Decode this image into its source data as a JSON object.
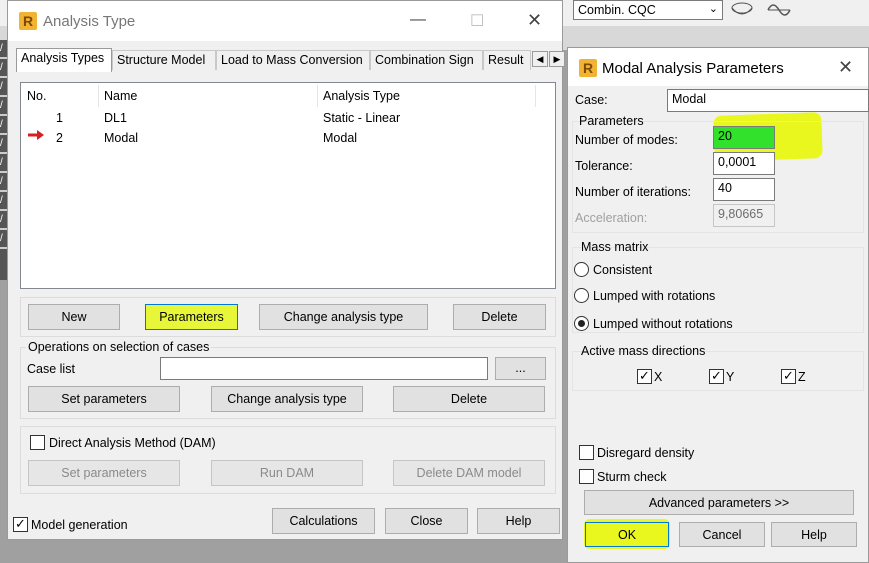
{
  "background": {
    "combo_value": "Combin. CQC",
    "left_marks": [
      "/",
      "/",
      "/",
      "/",
      "/",
      "/",
      "/",
      "/",
      "/",
      "/",
      "/"
    ]
  },
  "analysis_dialog": {
    "title": "Analysis Type",
    "tabs": [
      "Analysis Types",
      "Structure Model",
      "Load to Mass Conversion",
      "Combination Sign",
      "Result"
    ],
    "columns": [
      "No.",
      "Name",
      "Analysis Type"
    ],
    "rows": [
      {
        "no": "1",
        "name": "DL1",
        "type": "Static - Linear"
      },
      {
        "no": "2",
        "name": "Modal",
        "type": "Modal"
      }
    ],
    "buttons": {
      "new": "New",
      "parameters": "Parameters",
      "change_type": "Change analysis type",
      "delete": "Delete"
    },
    "operations": {
      "label": "Operations on selection of cases",
      "case_list_label": "Case list",
      "case_list_value": "",
      "browse": "...",
      "set_parameters": "Set parameters",
      "change_type": "Change analysis type",
      "delete": "Delete"
    },
    "dam": {
      "label": "Direct Analysis Method (DAM)",
      "set_parameters": "Set parameters",
      "run": "Run DAM",
      "delete_model": "Delete DAM model"
    },
    "model_generation": "Model generation",
    "footer": {
      "calculations": "Calculations",
      "close": "Close",
      "help": "Help"
    }
  },
  "modal_dialog": {
    "title": "Modal Analysis Parameters",
    "case_label": "Case:",
    "case_value": "Modal",
    "parameters_label": "Parameters",
    "modes_label": "Number of modes:",
    "modes_value": "20",
    "tolerance_label": "Tolerance:",
    "tolerance_value": "0,0001",
    "iterations_label": "Number of iterations:",
    "iterations_value": "40",
    "acceleration_label": "Acceleration:",
    "acceleration_value": "9,80665",
    "mass_matrix_label": "Mass matrix",
    "mass_options": [
      "Consistent",
      "Lumped with rotations",
      "Lumped without rotations"
    ],
    "mass_selected": "Lumped without rotations",
    "directions_label": "Active mass directions",
    "directions": [
      "X",
      "Y",
      "Z"
    ],
    "disregard_density": "Disregard density",
    "sturm_check": "Sturm check",
    "advanced": "Advanced parameters >>",
    "ok": "OK",
    "cancel": "Cancel",
    "help": "Help"
  }
}
